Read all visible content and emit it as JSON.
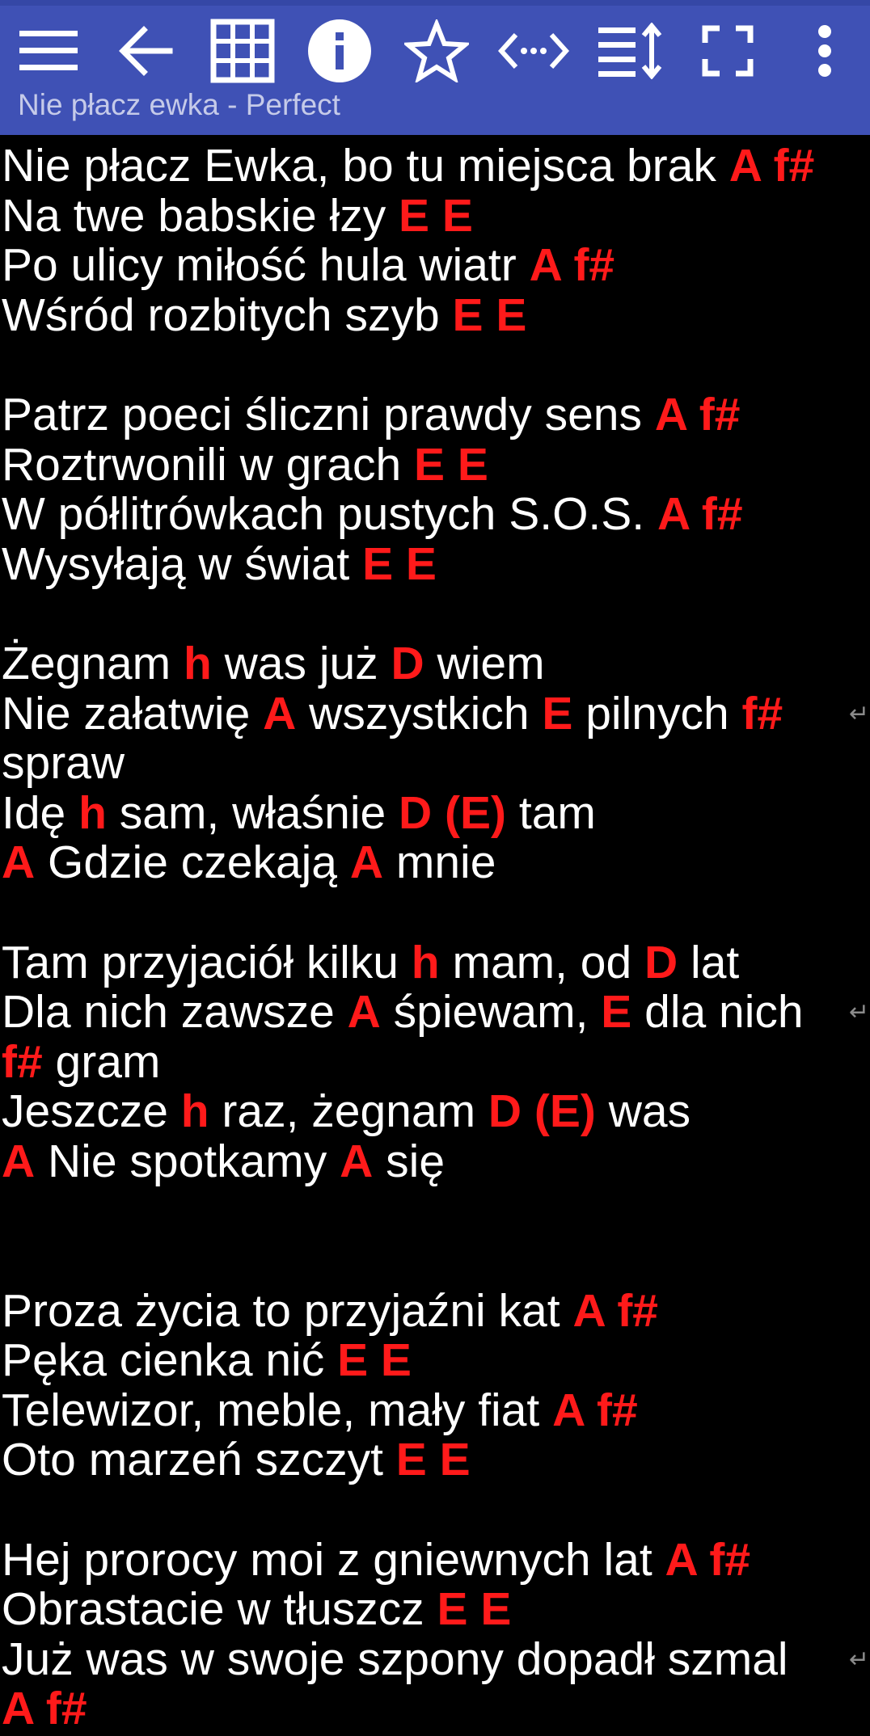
{
  "toolbar": {
    "title": "Nie płacz ewka - Perfect",
    "buttons": [
      {
        "name": "menu-icon"
      },
      {
        "name": "back-arrow-icon"
      },
      {
        "name": "grid-icon"
      },
      {
        "name": "info-icon"
      },
      {
        "name": "star-icon"
      },
      {
        "name": "code-arrows-icon"
      },
      {
        "name": "text-size-icon"
      },
      {
        "name": "fullscreen-icon"
      },
      {
        "name": "more-vert-icon"
      }
    ]
  },
  "colors": {
    "toolbar_bg": "#3f51b5",
    "text": "#ffffff",
    "chord": "#ff1a1a",
    "background": "#000000"
  },
  "wrap_symbol": "↵",
  "lyrics": [
    {
      "parts": [
        {
          "t": "Nie płacz Ewka, bo tu miejsca brak "
        },
        {
          "c": "A f#"
        }
      ]
    },
    {
      "parts": [
        {
          "t": "Na twe babskie łzy "
        },
        {
          "c": "E E"
        }
      ]
    },
    {
      "parts": [
        {
          "t": "Po ulicy miłość hula wiatr "
        },
        {
          "c": "A f#"
        }
      ]
    },
    {
      "parts": [
        {
          "t": "Wśród rozbitych szyb "
        },
        {
          "c": "E E"
        }
      ]
    },
    {
      "blank": true
    },
    {
      "parts": [
        {
          "t": "Patrz poeci śliczni prawdy sens "
        },
        {
          "c": "A f#"
        }
      ]
    },
    {
      "parts": [
        {
          "t": "Roztrwonili w grach "
        },
        {
          "c": "E E"
        }
      ]
    },
    {
      "parts": [
        {
          "t": "W półlitrówkach pustych S.O.S. "
        },
        {
          "c": "A f#"
        }
      ]
    },
    {
      "parts": [
        {
          "t": "Wysyłają w świat "
        },
        {
          "c": "E E"
        }
      ]
    },
    {
      "blank": true
    },
    {
      "parts": [
        {
          "t": "Żegnam "
        },
        {
          "c": "h"
        },
        {
          "t": " was już "
        },
        {
          "c": "D"
        },
        {
          "t": " wiem"
        }
      ]
    },
    {
      "wrap": true,
      "parts": [
        {
          "t": "Nie załatwię "
        },
        {
          "c": "A"
        },
        {
          "t": " wszystkich "
        },
        {
          "c": "E"
        },
        {
          "t": " pilnych "
        },
        {
          "c": "f#"
        }
      ]
    },
    {
      "parts": [
        {
          "t": "spraw"
        }
      ]
    },
    {
      "parts": [
        {
          "t": "Idę "
        },
        {
          "c": "h"
        },
        {
          "t": " sam, właśnie "
        },
        {
          "c": "D (E)"
        },
        {
          "t": " tam"
        }
      ]
    },
    {
      "parts": [
        {
          "c": "A"
        },
        {
          "t": " Gdzie czekają "
        },
        {
          "c": "A"
        },
        {
          "t": " mnie"
        }
      ]
    },
    {
      "blank": true
    },
    {
      "parts": [
        {
          "t": "Tam przyjaciół kilku "
        },
        {
          "c": "h"
        },
        {
          "t": " mam, od "
        },
        {
          "c": "D"
        },
        {
          "t": " lat"
        }
      ]
    },
    {
      "wrap": true,
      "parts": [
        {
          "t": "Dla nich zawsze "
        },
        {
          "c": "A"
        },
        {
          "t": " śpiewam, "
        },
        {
          "c": "E"
        },
        {
          "t": " dla nich"
        }
      ]
    },
    {
      "parts": [
        {
          "c": "f#"
        },
        {
          "t": " gram"
        }
      ]
    },
    {
      "parts": [
        {
          "t": "Jeszcze "
        },
        {
          "c": "h"
        },
        {
          "t": " raz, żegnam "
        },
        {
          "c": "D (E)"
        },
        {
          "t": " was"
        }
      ]
    },
    {
      "parts": [
        {
          "c": "A"
        },
        {
          "t": " Nie spotkamy "
        },
        {
          "c": "A"
        },
        {
          "t": " się"
        }
      ]
    },
    {
      "blank": true
    },
    {
      "blank": true
    },
    {
      "parts": [
        {
          "t": "Proza życia to przyjaźni kat "
        },
        {
          "c": "A f#"
        }
      ]
    },
    {
      "parts": [
        {
          "t": "Pęka cienka nić "
        },
        {
          "c": "E E"
        }
      ]
    },
    {
      "parts": [
        {
          "t": "Telewizor, meble, mały fiat "
        },
        {
          "c": "A f#"
        }
      ]
    },
    {
      "parts": [
        {
          "t": "Oto marzeń szczyt "
        },
        {
          "c": "E E"
        }
      ]
    },
    {
      "blank": true
    },
    {
      "parts": [
        {
          "t": "Hej prorocy moi z gniewnych lat "
        },
        {
          "c": "A f#"
        }
      ]
    },
    {
      "parts": [
        {
          "t": "Obrastacie w tłuszcz "
        },
        {
          "c": "E E"
        }
      ]
    },
    {
      "wrap": true,
      "parts": [
        {
          "t": "Już was w swoje szpony dopadł szmal"
        }
      ]
    },
    {
      "parts": [
        {
          "c": "A f#"
        }
      ]
    }
  ]
}
